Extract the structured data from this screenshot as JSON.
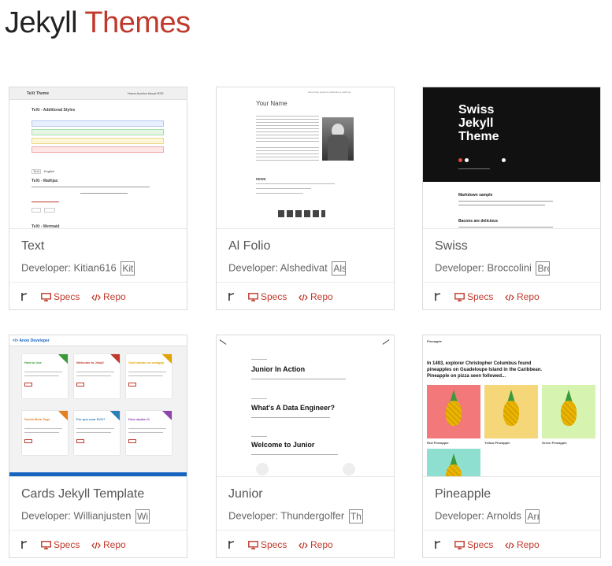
{
  "site": {
    "title_part1": "Jekyll ",
    "title_part2": "Themes"
  },
  "labels": {
    "developer_prefix": "Developer: ",
    "specs": "Specs",
    "repo": "Repo"
  },
  "colors": {
    "accent": "#c0392b",
    "border": "#dcdcdc"
  },
  "themes": [
    {
      "name": "Text",
      "developer": "Kitian616",
      "avatar_alt": "Kit"
    },
    {
      "name": "Al Folio",
      "developer": "Alshedivat",
      "avatar_alt": "Als"
    },
    {
      "name": "Swiss",
      "developer": "Broccolini",
      "avatar_alt": "Bro"
    },
    {
      "name": "Cards Jekyll Template",
      "developer": "Willianjusten",
      "avatar_alt": "Wi"
    },
    {
      "name": "Junior",
      "developer": "Thundergolfer",
      "avatar_alt": "Th"
    },
    {
      "name": "Pineapple",
      "developer": "Arnolds",
      "avatar_alt": "Arı"
    }
  ],
  "thumbs": {
    "text": {
      "header": "TeXt Theme",
      "nav": "Home  Archive  About  RSS",
      "h1": "TeXt - Additional Styles",
      "h2": "TeXt - Mathjax",
      "h3": "TeXt - Mermaid",
      "tag1": "TeXt",
      "tag2": "English"
    },
    "alfolio": {
      "name": "Your Name",
      "nav": "about  blog  projects  publications  teaching",
      "news": "news"
    },
    "swiss": {
      "title": "Swiss Jekyll Theme",
      "post1": "Markdown sample",
      "post2": "Bacons are delicious"
    },
    "cards": {
      "brand": "</> Anon Developer",
      "c1": "How to Use",
      "c2": "Welcome to Jekyll",
      "c3": "Oral tomato no ondigaji",
      "c4": "Social Meta Tags",
      "c5": "Por que usar SVG?",
      "c6": "Dica rápida #1"
    },
    "junior": {
      "p1": "Junior In Action",
      "p2": "What's A Data Engineer?",
      "p3": "Welcome to Junior"
    },
    "pineapple": {
      "brand": "Pineapple",
      "intro": "In 1493, explorer Christopher Columbus found pineapples on Guadeloupe Island in the Caribbean. Pineapple on pizza seen followed...",
      "l1": "Red Pineapple",
      "l2": "Yellow Pineapple",
      "l3": "Green Pineapple"
    }
  }
}
